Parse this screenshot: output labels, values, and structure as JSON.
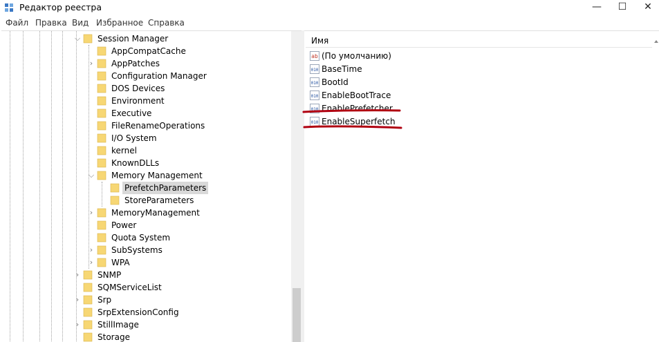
{
  "window": {
    "title": "Редактор реестра",
    "controls": {
      "minimize": "—",
      "maximize": "☐",
      "close": "✕"
    }
  },
  "menu": [
    "Файл",
    "Правка",
    "Вид",
    "Избранное",
    "Справка"
  ],
  "tree": {
    "nodes": [
      {
        "label": "Session Manager",
        "expander": "⌵"
      },
      {
        "label": "AppCompatCache",
        "expander": ""
      },
      {
        "label": "AppPatches",
        "expander": "›"
      },
      {
        "label": "Configuration Manager",
        "expander": ""
      },
      {
        "label": "DOS Devices",
        "expander": ""
      },
      {
        "label": "Environment",
        "expander": ""
      },
      {
        "label": "Executive",
        "expander": ""
      },
      {
        "label": "FileRenameOperations",
        "expander": ""
      },
      {
        "label": "I/O System",
        "expander": ""
      },
      {
        "label": "kernel",
        "expander": ""
      },
      {
        "label": "KnownDLLs",
        "expander": ""
      },
      {
        "label": "Memory Management",
        "expander": "⌵"
      },
      {
        "label": "PrefetchParameters",
        "expander": "",
        "selected": true
      },
      {
        "label": "StoreParameters",
        "expander": ""
      },
      {
        "label": "MemoryManagement",
        "expander": "›"
      },
      {
        "label": "Power",
        "expander": ""
      },
      {
        "label": "Quota System",
        "expander": ""
      },
      {
        "label": "SubSystems",
        "expander": "›"
      },
      {
        "label": "WPA",
        "expander": "›"
      },
      {
        "label": "SNMP",
        "expander": "›"
      },
      {
        "label": "SQMServiceList",
        "expander": ""
      },
      {
        "label": "Srp",
        "expander": "›"
      },
      {
        "label": "SrpExtensionConfig",
        "expander": ""
      },
      {
        "label": "StillImage",
        "expander": "›"
      },
      {
        "label": "Storage",
        "expander": ""
      }
    ]
  },
  "values_pane": {
    "column_header": "Имя",
    "rows": [
      {
        "name": "(По умолчанию)",
        "icon": "string-value-icon"
      },
      {
        "name": "BaseTime",
        "icon": "binary-value-icon"
      },
      {
        "name": "BootId",
        "icon": "binary-value-icon"
      },
      {
        "name": "EnableBootTrace",
        "icon": "binary-value-icon"
      },
      {
        "name": "EnablePrefetcher",
        "icon": "binary-value-icon",
        "underlined": true
      },
      {
        "name": "EnableSuperfetch",
        "icon": "binary-value-icon",
        "underlined": true
      }
    ]
  },
  "colors": {
    "folder": "#f7d774",
    "folder_edge": "#d8b24a",
    "selection": "#d9d9d9",
    "annotation_red": "#b00010",
    "string_icon": "#c0392b",
    "binary_icon": "#1f4e9e"
  }
}
